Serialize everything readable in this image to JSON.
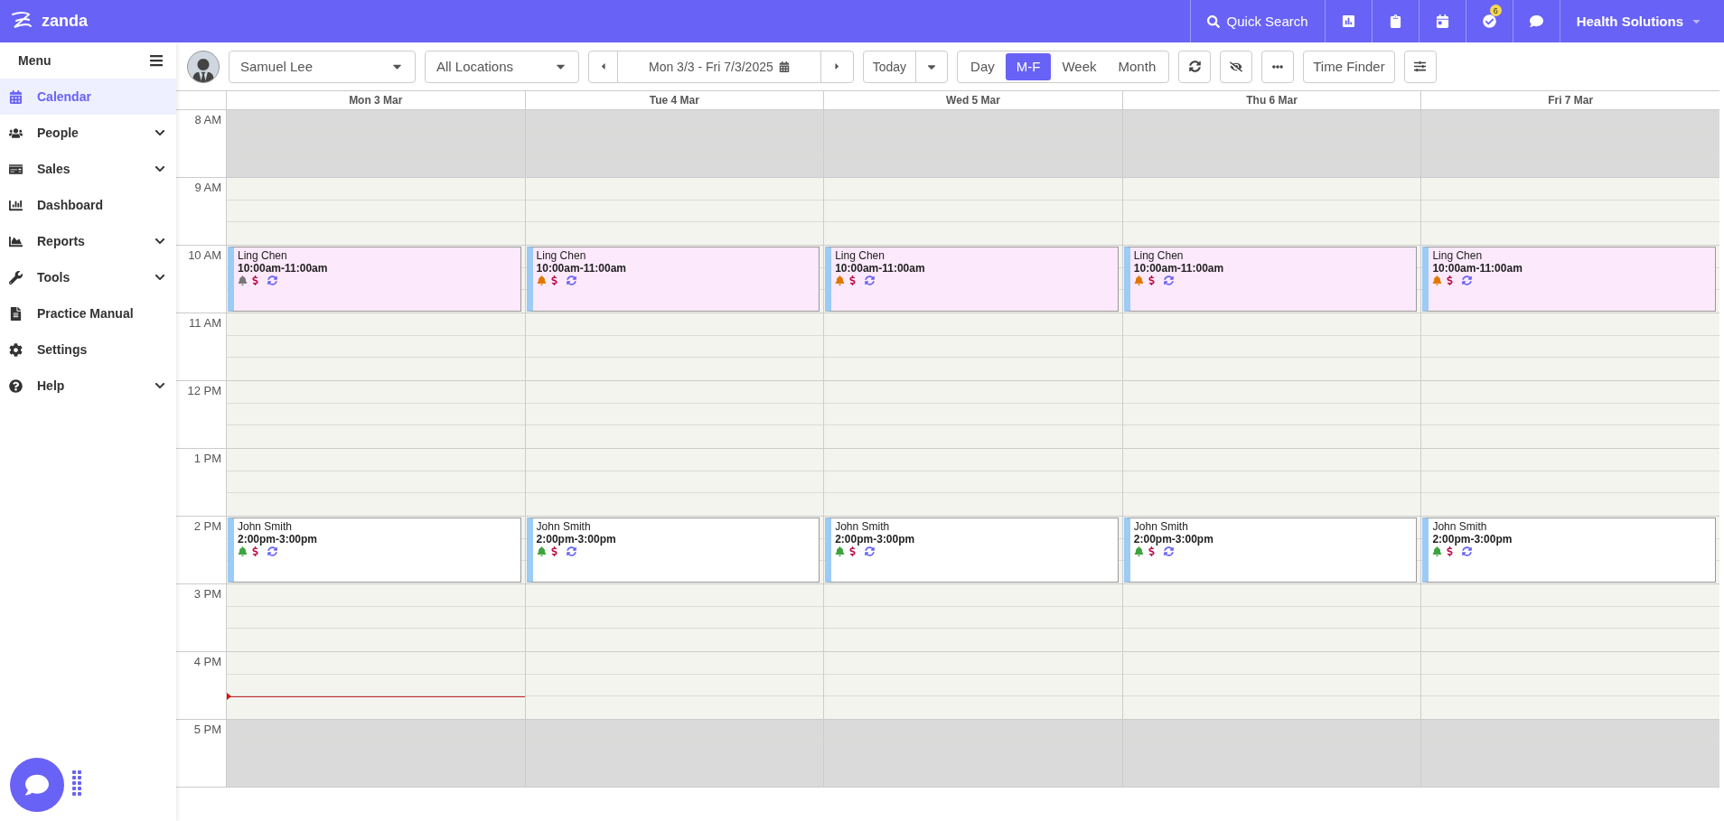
{
  "topbar": {
    "brand": "zanda",
    "search_label": "Quick Search",
    "tasks_badge": "6",
    "account": "Health Solutions"
  },
  "sidebar": {
    "title": "Menu",
    "items": [
      {
        "label": "Calendar",
        "selected": true,
        "expandable": false
      },
      {
        "label": "People",
        "selected": false,
        "expandable": true
      },
      {
        "label": "Sales",
        "selected": false,
        "expandable": true
      },
      {
        "label": "Dashboard",
        "selected": false,
        "expandable": false
      },
      {
        "label": "Reports",
        "selected": false,
        "expandable": true
      },
      {
        "label": "Tools",
        "selected": false,
        "expandable": true
      },
      {
        "label": "Practice Manual",
        "selected": false,
        "expandable": false
      },
      {
        "label": "Settings",
        "selected": false,
        "expandable": false
      },
      {
        "label": "Help",
        "selected": false,
        "expandable": true
      }
    ]
  },
  "toolbar": {
    "staff": "Samuel Lee",
    "location": "All Locations",
    "date_range": "Mon 3/3 - Fri 7/3/2025",
    "today": "Today",
    "views": [
      {
        "label": "Day",
        "selected": false
      },
      {
        "label": "M-F",
        "selected": true
      },
      {
        "label": "Week",
        "selected": false
      },
      {
        "label": "Month",
        "selected": false
      }
    ],
    "time_finder": "Time Finder"
  },
  "days": [
    {
      "label": "Mon 3 Mar",
      "now_line": true
    },
    {
      "label": "Tue 4 Mar",
      "now_line": false
    },
    {
      "label": "Wed 5 Mar",
      "now_line": false
    },
    {
      "label": "Thu 6 Mar",
      "now_line": false
    },
    {
      "label": "Fri 7 Mar",
      "now_line": false
    }
  ],
  "hours": [
    {
      "label": "8 AM",
      "closed": true
    },
    {
      "label": "9 AM",
      "closed": false
    },
    {
      "label": "10 AM",
      "closed": false,
      "appointments": [
        {
          "name": "Ling Chen",
          "time": "10:00am-11:00am",
          "kind": "tinted",
          "color": "#777777"
        },
        {
          "name": "Ling Chen",
          "time": "10:00am-11:00am",
          "kind": "tinted",
          "color": "#e07800"
        },
        {
          "name": "Ling Chen",
          "time": "10:00am-11:00am",
          "kind": "tinted",
          "color": "#e07800"
        },
        {
          "name": "Ling Chen",
          "time": "10:00am-11:00am",
          "kind": "tinted",
          "color": "#e07800"
        },
        {
          "name": "Ling Chen",
          "time": "10:00am-11:00am",
          "kind": "tinted",
          "color": "#e07800"
        }
      ]
    },
    {
      "label": "11 AM",
      "closed": false
    },
    {
      "label": "12 PM",
      "closed": false
    },
    {
      "label": "1 PM",
      "closed": false
    },
    {
      "label": "2 PM",
      "closed": false,
      "appointments": [
        {
          "name": "John Smith",
          "time": "2:00pm-3:00pm",
          "kind": "plain",
          "color": "#3ea33e"
        },
        {
          "name": "John Smith",
          "time": "2:00pm-3:00pm",
          "kind": "plain",
          "color": "#3ea33e"
        },
        {
          "name": "John Smith",
          "time": "2:00pm-3:00pm",
          "kind": "plain",
          "color": "#3ea33e"
        },
        {
          "name": "John Smith",
          "time": "2:00pm-3:00pm",
          "kind": "plain",
          "color": "#3ea33e"
        },
        {
          "name": "John Smith",
          "time": "2:00pm-3:00pm",
          "kind": "plain",
          "color": "#3ea33e"
        }
      ]
    },
    {
      "label": "3 PM",
      "closed": false
    },
    {
      "label": "4 PM",
      "closed": false
    },
    {
      "label": "5 PM",
      "closed": true
    }
  ]
}
